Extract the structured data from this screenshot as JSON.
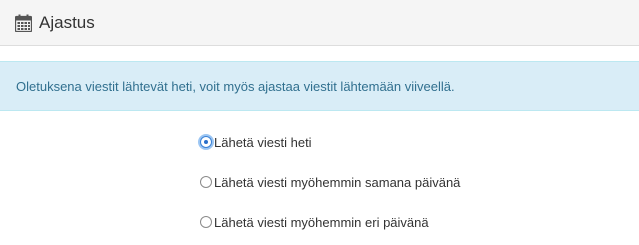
{
  "header": {
    "icon": "calendar-icon",
    "title": "Ajastus"
  },
  "info": {
    "text": "Oletuksena viestit lähtevät heti, voit myös ajastaa viestit lähtemään viiveellä."
  },
  "schedule_options": [
    {
      "label": "Lähetä viesti heti",
      "checked": true
    },
    {
      "label": "Lähetä viesti myöhemmin samana päivänä",
      "checked": false
    },
    {
      "label": "Lähetä viesti myöhemmin eri päivänä",
      "checked": false
    }
  ],
  "colors": {
    "header_bg": "#f5f5f5",
    "info_bg": "#d9edf7",
    "info_text": "#31708f",
    "radio_accent": "#3b82d6"
  }
}
